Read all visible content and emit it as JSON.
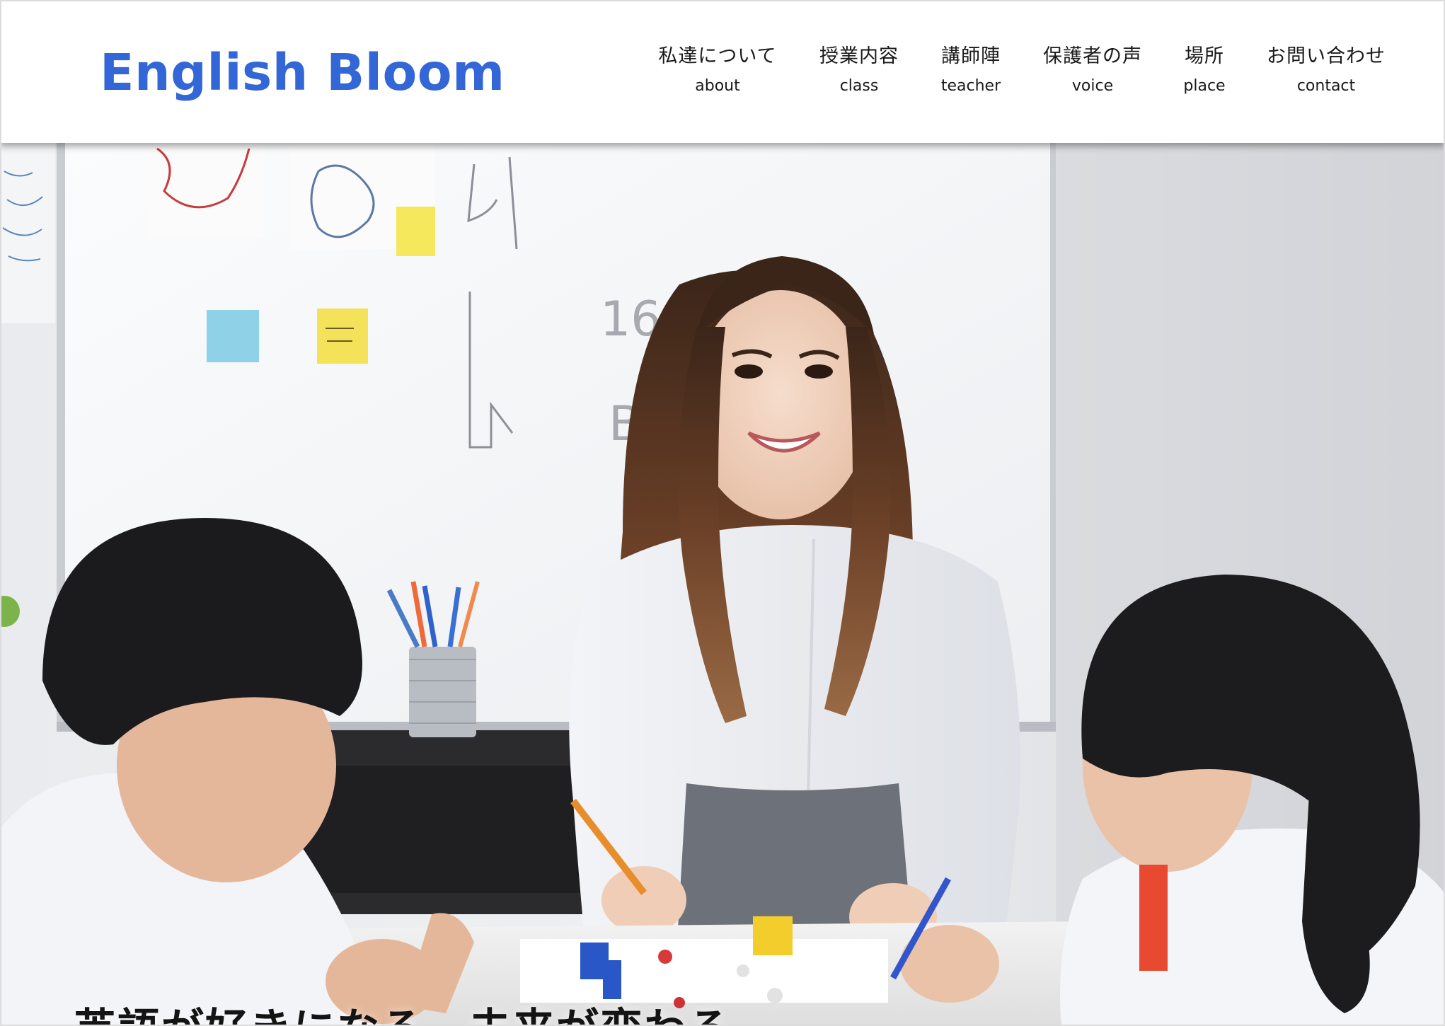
{
  "header": {
    "logo": "English Bloom"
  },
  "nav": [
    {
      "jp": "私達について",
      "en": "about"
    },
    {
      "jp": "授業内容",
      "en": "class"
    },
    {
      "jp": "講師陣",
      "en": "teacher"
    },
    {
      "jp": "保護者の声",
      "en": "voice"
    },
    {
      "jp": "場所",
      "en": "place"
    },
    {
      "jp": "お問い合わせ",
      "en": "contact"
    }
  ],
  "hero": {
    "tagline": "英語が好きになる、未来が変わる",
    "image": "classroom-photo",
    "whiteboard_notes": [
      "16ext",
      "B-"
    ]
  },
  "colors": {
    "brand": "#3366d6",
    "nav_text": "#1a1a1a",
    "header_bg": "#ffffff",
    "tagline": "#141414"
  }
}
